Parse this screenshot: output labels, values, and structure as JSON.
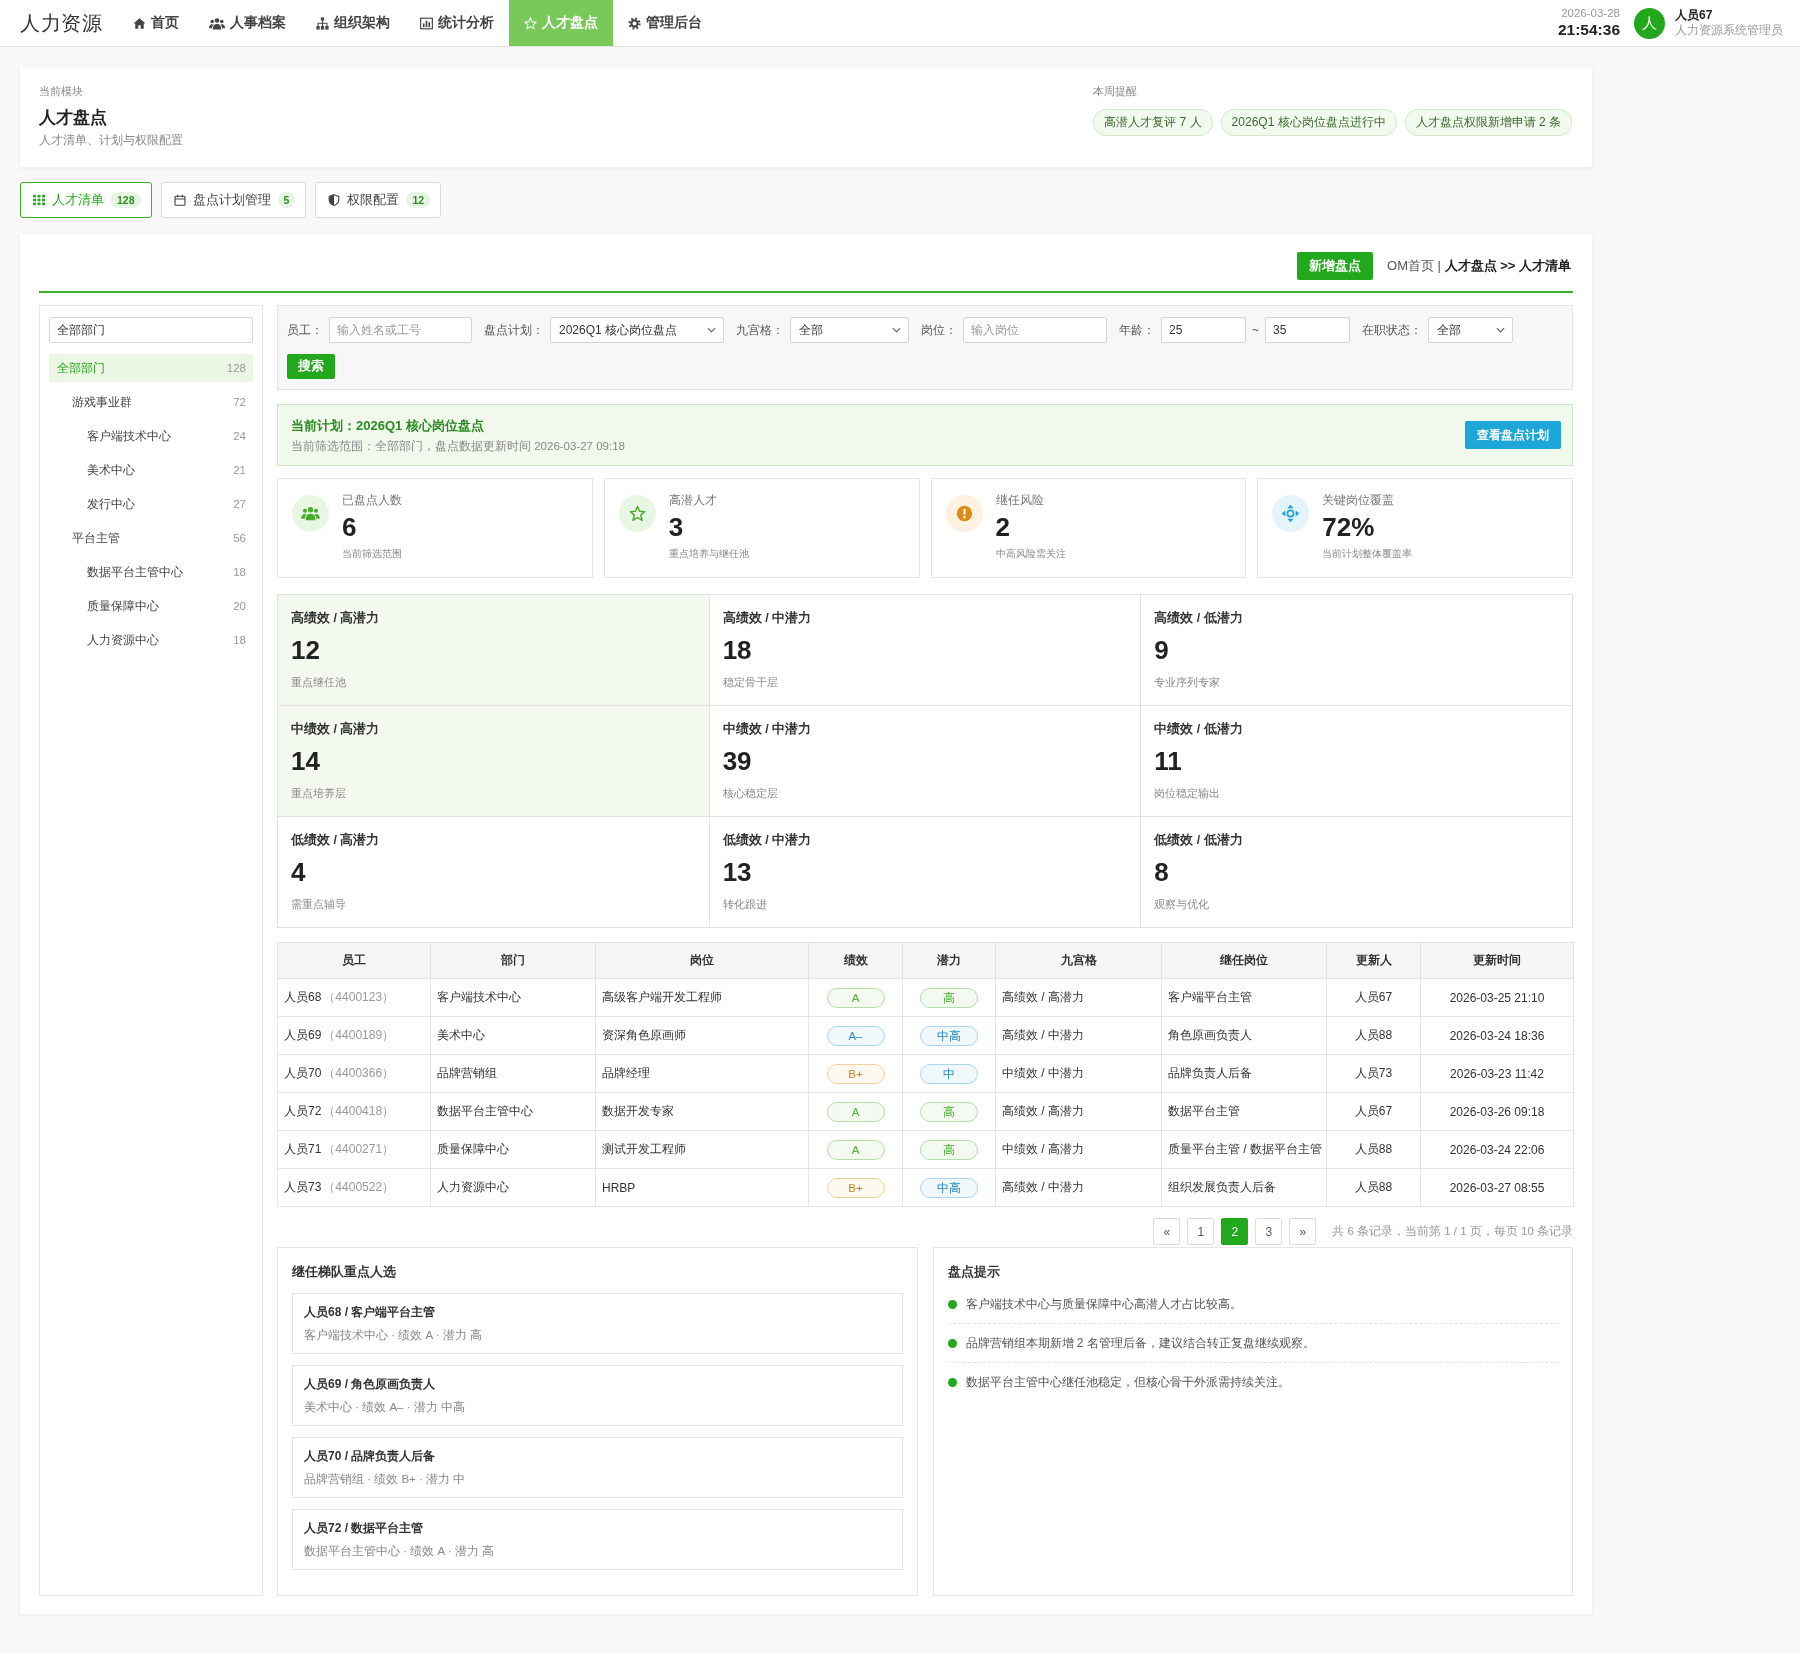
{
  "top_nav": {
    "logo": "人力资源",
    "items": [
      {
        "label": "首页",
        "selected": false
      },
      {
        "label": "人事档案",
        "selected": false
      },
      {
        "label": "组织架构",
        "selected": false
      },
      {
        "label": "统计分析",
        "selected": false
      },
      {
        "label": "人才盘点",
        "selected": true
      },
      {
        "label": "管理后台",
        "selected": false
      }
    ],
    "date": "2026-03-28",
    "time": "21:54:36",
    "user": {
      "avatar": "人",
      "name": "人员67",
      "role": "人力资源系统管理员"
    }
  },
  "header": {
    "caption": "当前模块",
    "title": "人才盘点",
    "subtitle": "人才清单、计划与权限配置",
    "reminder_label": "本周提醒",
    "reminders": [
      "高潜人才复评 7 人",
      "2026Q1 核心岗位盘点进行中",
      "人才盘点权限新增申请 2 条"
    ]
  },
  "tabs": [
    {
      "label": "人才清单",
      "count": "128",
      "selected": true
    },
    {
      "label": "盘点计划管理",
      "count": "5",
      "selected": false
    },
    {
      "label": "权限配置",
      "count": "12",
      "selected": false
    }
  ],
  "toolbar": {
    "button": "新增盘点",
    "breadcrumb": "OM首页 | **人才盘点 >> 人才清单**"
  },
  "sidebar": {
    "search_value": "全部部门",
    "tree": [
      {
        "label": "全部部门",
        "count": "128",
        "selected": true,
        "children": [
          {
            "label": "游戏事业群",
            "count": "72",
            "selected": false,
            "children": [
              {
                "label": "客户端技术中心",
                "count": "24",
                "selected": false
              },
              {
                "label": "美术中心",
                "count": "21",
                "selected": false
              },
              {
                "label": "发行中心",
                "count": "27",
                "selected": false
              }
            ]
          },
          {
            "label": "平台主管",
            "count": "56",
            "selected": false,
            "children": [
              {
                "label": "数据平台主管中心",
                "count": "18",
                "selected": false
              },
              {
                "label": "质量保障中心",
                "count": "20",
                "selected": false
              },
              {
                "label": "人力资源中心",
                "count": "18",
                "selected": false
              }
            ]
          }
        ]
      }
    ]
  },
  "filters": {
    "fields": [
      {
        "kind": "input",
        "label": "员工：",
        "placeholder": "输入姓名或工号"
      },
      {
        "kind": "select",
        "label": "盘点计划：",
        "value": "2026Q1 核心岗位盘点"
      },
      {
        "kind": "select",
        "label": "九宫格：",
        "value": "全部"
      },
      {
        "kind": "input",
        "label": "岗位：",
        "placeholder": "输入岗位"
      },
      {
        "kind": "range",
        "label": "年龄：",
        "from": "25",
        "separator": "~",
        "to": "35"
      },
      {
        "kind": "select",
        "label": "在职状态：",
        "value": "全部"
      }
    ],
    "search_button": "搜索"
  },
  "plan_banner": {
    "title": "当前计划：2026Q1 核心岗位盘点",
    "note": "当前筛选范围：全部部门，盘点数据更新时间 2026-03-27 09:18",
    "button": "查看盘点计划"
  },
  "stats": [
    {
      "label": "已盘点人数",
      "value": "6",
      "note": "当前筛选范围",
      "color": "#e8f6e4"
    },
    {
      "label": "高潜人才",
      "value": "3",
      "note": "重点培养与继任池",
      "color": "#e8f6e4"
    },
    {
      "label": "继任风险",
      "value": "2",
      "note": "中高风险需关注",
      "color": "#fdf1e0"
    },
    {
      "label": "关键岗位覆盖",
      "value": "72%",
      "note": "当前计划整体覆盖率",
      "color": "#e3f4fb"
    }
  ],
  "nine_grid": [
    {
      "title": "高绩效 / 高潜力",
      "value": "12",
      "note": "重点继任池",
      "highlighted": true
    },
    {
      "title": "高绩效 / 中潜力",
      "value": "18",
      "note": "稳定骨干层",
      "highlighted": false
    },
    {
      "title": "高绩效 / 低潜力",
      "value": "9",
      "note": "专业序列专家",
      "highlighted": false
    },
    {
      "title": "中绩效 / 高潜力",
      "value": "14",
      "note": "重点培养层",
      "highlighted": true
    },
    {
      "title": "中绩效 / 中潜力",
      "value": "39",
      "note": "核心稳定层",
      "highlighted": false
    },
    {
      "title": "中绩效 / 低潜力",
      "value": "11",
      "note": "岗位稳定输出",
      "highlighted": false
    },
    {
      "title": "低绩效 / 高潜力",
      "value": "4",
      "note": "需重点辅导",
      "highlighted": false
    },
    {
      "title": "低绩效 / 中潜力",
      "value": "13",
      "note": "转化跟进",
      "highlighted": false
    },
    {
      "title": "低绩效 / 低潜力",
      "value": "8",
      "note": "观察与优化",
      "highlighted": false
    }
  ],
  "table": {
    "columns": [
      "员工",
      "部门",
      "岗位",
      "绩效",
      "潜力",
      "九宫格",
      "继任岗位",
      "更新人",
      "更新时间"
    ],
    "rows": [
      {
        "employee": "人员68",
        "employee_id": "（4400123）",
        "department": "客户端技术中心",
        "position": "高级客户端开发工程师",
        "performance": {
          "text": "A",
          "color": "#b5dcaa"
        },
        "potential": {
          "text": "高",
          "color": "#b5dcaa"
        },
        "grid": "高绩效 / 高潜力",
        "successor_role": "客户端平台主管",
        "updater": "人员67",
        "updated": "2026-03-25 21:10"
      },
      {
        "employee": "人员69",
        "employee_id": "（4400189）",
        "department": "美术中心",
        "position": "资深角色原画师",
        "performance": {
          "text": "A–",
          "color": "#a9d7ee"
        },
        "potential": {
          "text": "中高",
          "color": "#a9d7ee"
        },
        "grid": "高绩效 / 中潜力",
        "successor_role": "角色原画负责人",
        "updater": "人员88",
        "updated": "2026-03-24 18:36"
      },
      {
        "employee": "人员70",
        "employee_id": "（4400366）",
        "department": "品牌营销组",
        "position": "品牌经理",
        "performance": {
          "text": "B+",
          "color": "#f0d2a0"
        },
        "potential": {
          "text": "中",
          "color": "#a9d7ee"
        },
        "grid": "中绩效 / 中潜力",
        "successor_role": "品牌负责人后备",
        "updater": "人员73",
        "updated": "2026-03-23 11:42"
      },
      {
        "employee": "人员72",
        "employee_id": "（4400418）",
        "department": "数据平台主管中心",
        "position": "数据开发专家",
        "performance": {
          "text": "A",
          "color": "#b5dcaa"
        },
        "potential": {
          "text": "高",
          "color": "#b5dcaa"
        },
        "grid": "高绩效 / 高潜力",
        "successor_role": "数据平台主管",
        "updater": "人员67",
        "updated": "2026-03-26 09:18"
      },
      {
        "employee": "人员71",
        "employee_id": "（4400271）",
        "department": "质量保障中心",
        "position": "测试开发工程师",
        "performance": {
          "text": "A",
          "color": "#b5dcaa"
        },
        "potential": {
          "text": "高",
          "color": "#b5dcaa"
        },
        "grid": "中绩效 / 高潜力",
        "successor_role": "质量平台主管 / 数据平台主管",
        "updater": "人员88",
        "updated": "2026-03-24 22:06"
      },
      {
        "employee": "人员73",
        "employee_id": "（4400522）",
        "department": "人力资源中心",
        "position": "HRBP",
        "performance": {
          "text": "B+",
          "color": "#f0d2a0"
        },
        "potential": {
          "text": "中高",
          "color": "#a9d7ee"
        },
        "grid": "高绩效 / 中潜力",
        "successor_role": "组织发展负责人后备",
        "updater": "人员88",
        "updated": "2026-03-27 08:55"
      }
    ]
  },
  "pagination": {
    "pages": [
      {
        "label": "«",
        "selected": false
      },
      {
        "label": "1",
        "selected": false
      },
      {
        "label": "2",
        "selected": true
      },
      {
        "label": "3",
        "selected": false
      },
      {
        "label": "»",
        "selected": false
      }
    ],
    "summary": "共 6 条记录，当前第 1 / 1 页，每页 10 条记录"
  },
  "successors": {
    "title": "继任梯队重点人选",
    "items": [
      {
        "title": "人员68 / 客户端平台主管",
        "detail": "客户端技术中心 · 绩效 A · 潜力 高"
      },
      {
        "title": "人员69 / 角色原画负责人",
        "detail": "美术中心 · 绩效 A– · 潜力 中高"
      },
      {
        "title": "人员70 / 品牌负责人后备",
        "detail": "品牌营销组 · 绩效 B+ · 潜力 中"
      },
      {
        "title": "人员72 / 数据平台主管",
        "detail": "数据平台主管中心 · 绩效 A · 潜力 高"
      }
    ]
  },
  "tips": {
    "title": "盘点提示",
    "items": [
      "客户端技术中心与质量保障中心高潜人才占比较高。",
      "品牌营销组本期新增 2 名管理后备，建议结合转正复盘继续观察。",
      "数据平台主管中心继任池稳定，但核心骨干外派需持续关注。"
    ]
  }
}
